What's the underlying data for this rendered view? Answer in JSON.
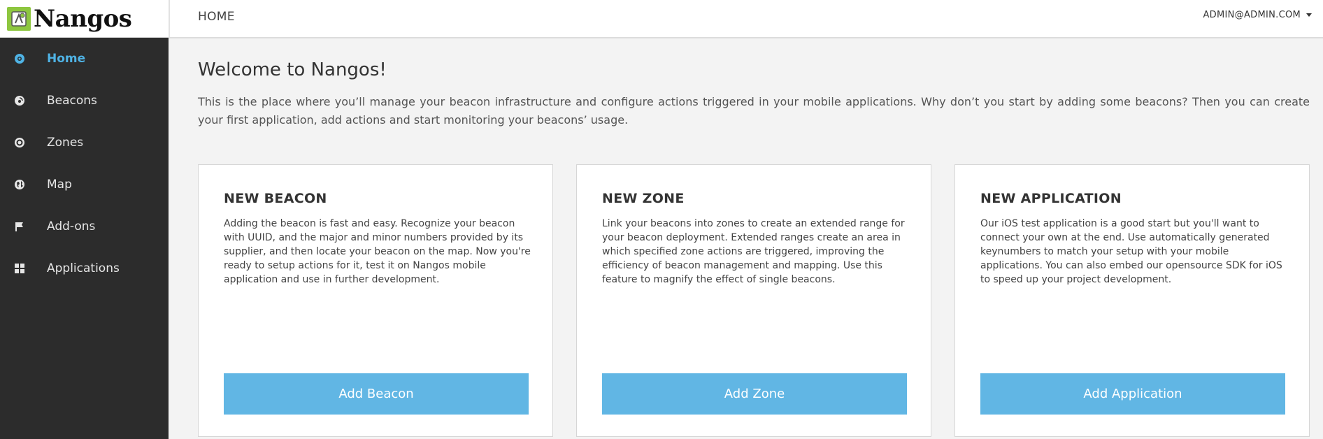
{
  "brand": {
    "name": "Nangos",
    "mark_color": "#8dc63f"
  },
  "header": {
    "breadcrumb": "HOME",
    "user": "ADMIN@ADMIN.COM"
  },
  "sidebar": {
    "items": [
      {
        "label": "Home",
        "icon": "home-icon",
        "active": true
      },
      {
        "label": "Beacons",
        "icon": "beacon-icon"
      },
      {
        "label": "Zones",
        "icon": "target-icon"
      },
      {
        "label": "Map",
        "icon": "globe-icon"
      },
      {
        "label": "Add-ons",
        "icon": "flag-icon"
      },
      {
        "label": "Applications",
        "icon": "grid-icon"
      }
    ]
  },
  "main": {
    "title": "Welcome to Nangos!",
    "intro": "This is the place where you’ll manage your beacon infrastructure and configure actions triggered in your mobile applications. Why don’t you start by adding some beacons? Then you can create your first application, add actions and start monitoring your beacons’ usage."
  },
  "cards": [
    {
      "title": "NEW BEACON",
      "text": "Adding the beacon is fast and easy. Recognize your beacon with UUID, and the major and minor numbers provided by its supplier, and then locate your beacon on the map. Now you're ready to setup actions for it, test it on Nangos mobile application and use in further development.",
      "button": "Add Beacon"
    },
    {
      "title": "NEW ZONE",
      "text": "Link your beacons into zones to create an extended range for your beacon deployment. Extended ranges create an area in which specified zone actions are triggered, improving the efficiency of beacon management and mapping. Use this feature to magnify the effect of single beacons.",
      "button": "Add Zone"
    },
    {
      "title": "NEW APPLICATION",
      "text": "Our iOS test application is a good start but you'll want to connect your own at the end. Use automatically generated keynumbers to match your setup with your mobile applications. You can also embed our opensource SDK for iOS to speed up your project development.",
      "button": "Add Application"
    }
  ],
  "colors": {
    "accent": "#4fb3e5",
    "button": "#61b6e4",
    "sidebar": "#2c2c2c"
  }
}
